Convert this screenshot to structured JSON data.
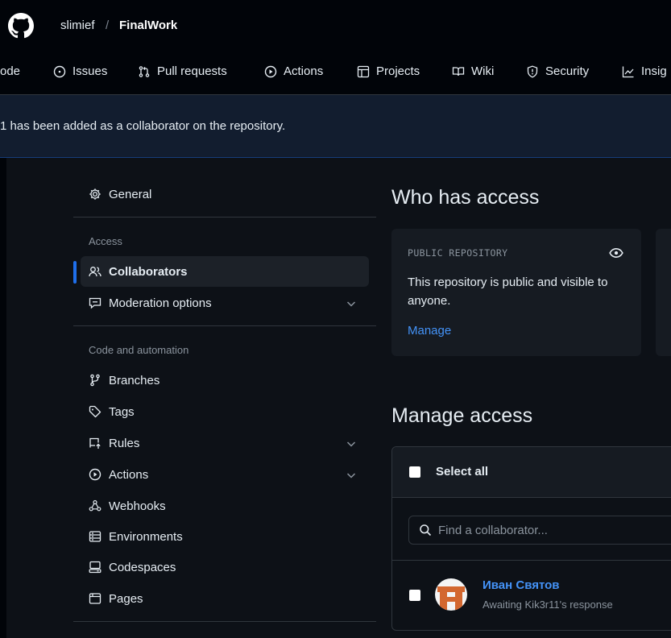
{
  "header": {
    "owner": "slimief",
    "separator": "/",
    "repo": "FinalWork"
  },
  "nav": {
    "code": "ode",
    "issues": "Issues",
    "pull_requests": "Pull requests",
    "actions": "Actions",
    "projects": "Projects",
    "wiki": "Wiki",
    "security": "Security",
    "insights": "Insig"
  },
  "flash": {
    "message": "1 has been added as a collaborator on the repository."
  },
  "sidebar": {
    "general": "General",
    "access_heading": "Access",
    "collaborators": "Collaborators",
    "moderation": "Moderation options",
    "code_heading": "Code and automation",
    "branches": "Branches",
    "tags": "Tags",
    "rules": "Rules",
    "actions": "Actions",
    "webhooks": "Webhooks",
    "environments": "Environments",
    "codespaces": "Codespaces",
    "pages": "Pages"
  },
  "who_has_access": {
    "title": "Who has access",
    "visibility_label": "PUBLIC REPOSITORY",
    "description": "This repository is public and visible to anyone.",
    "manage_link": "Manage"
  },
  "manage_access": {
    "title": "Manage access",
    "select_all": "Select all",
    "search_placeholder": "Find a collaborator...",
    "collaborator": {
      "name": "Иван Святов",
      "status": "Awaiting Kik3r11's response"
    }
  },
  "colors": {
    "accent": "#4493f8",
    "background": "#0d1117",
    "header": "#010409",
    "flash": "#121d2f"
  }
}
